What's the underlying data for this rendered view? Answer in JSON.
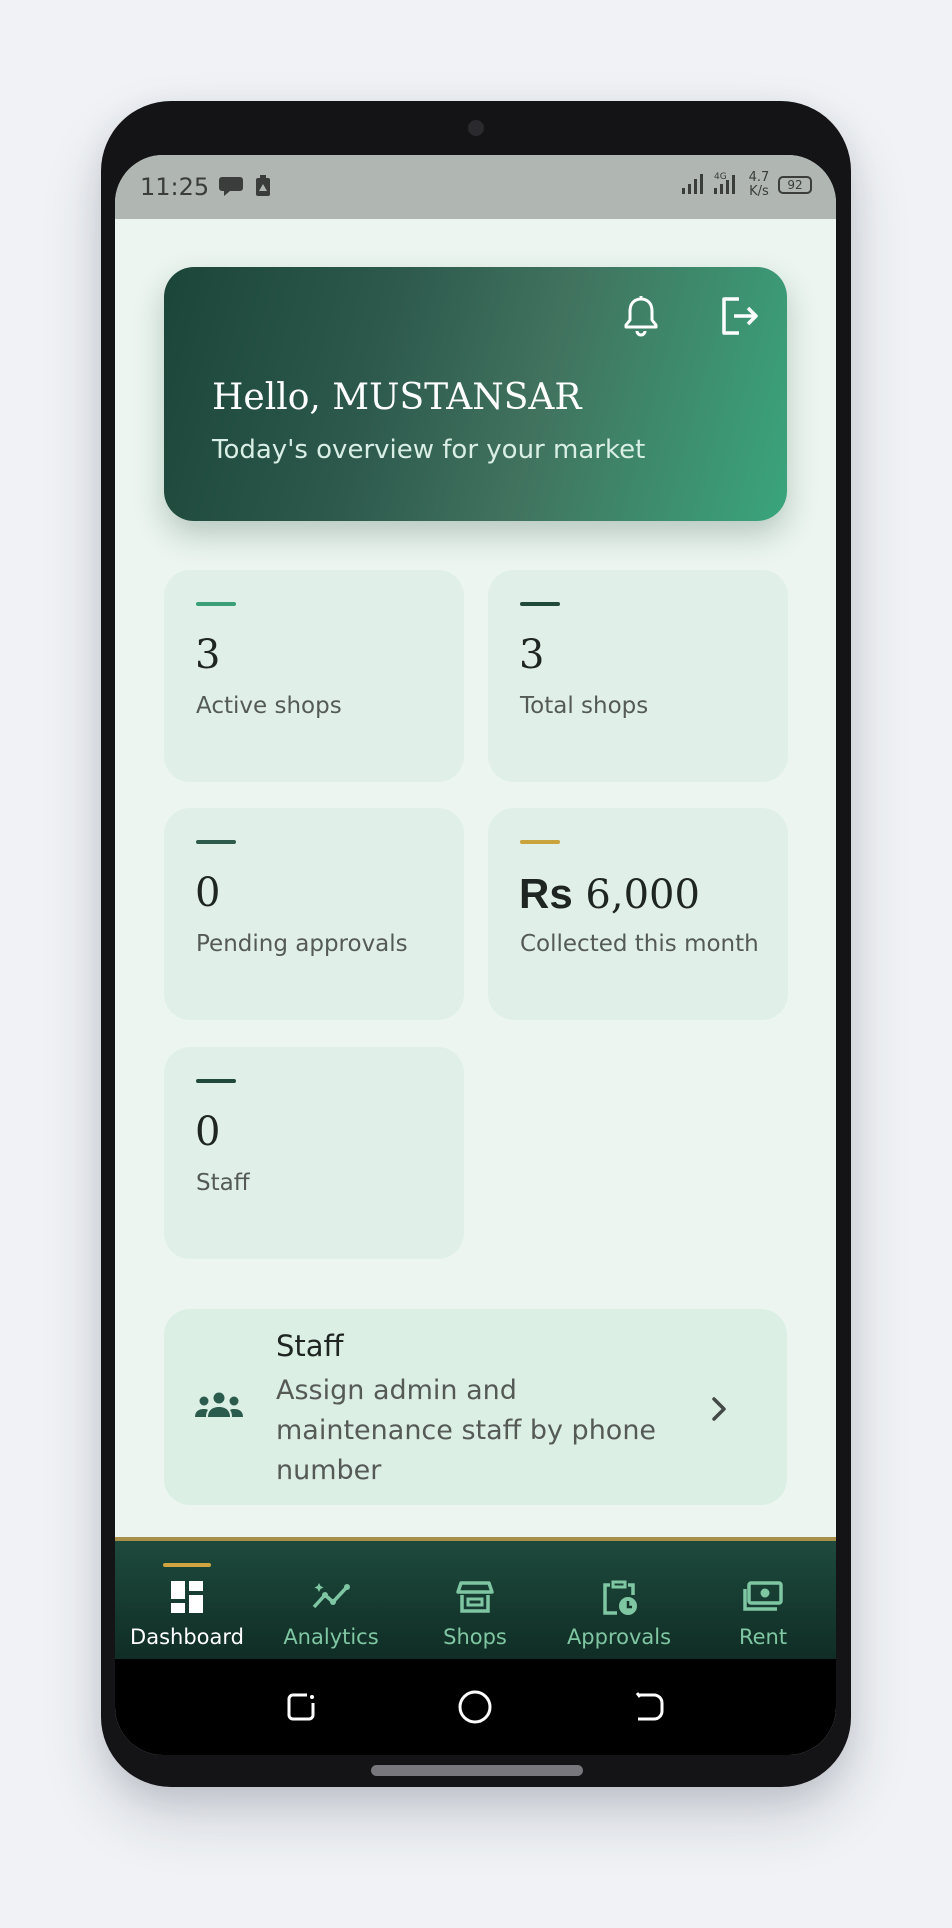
{
  "status_bar": {
    "time": "11:25",
    "network": "4G",
    "speed": "4.7\nK/s",
    "battery": "92"
  },
  "hero": {
    "greeting": "Hello, MUSTANSAR",
    "subtitle": "Today's overview for your market"
  },
  "stats": [
    {
      "value": "3",
      "label": "Active shops",
      "accent": "#3b9f78"
    },
    {
      "value": "3",
      "label": "Total shops",
      "accent": "#21493c"
    },
    {
      "value": "0",
      "label": "Pending approvals",
      "accent": "#2d5b4c"
    },
    {
      "currency": "Rs",
      "value": "6,000",
      "label": "Collected this month",
      "accent": "#c9a33c"
    },
    {
      "value": "0",
      "label": "Staff",
      "accent": "#21493c"
    }
  ],
  "staff_card": {
    "title": "Staff",
    "description": "Assign admin and maintenance staff by phone number"
  },
  "bottom_nav": {
    "items": [
      {
        "label": "Dashboard",
        "icon": "dashboard-icon",
        "active": true
      },
      {
        "label": "Analytics",
        "icon": "analytics-icon"
      },
      {
        "label": "Shops",
        "icon": "shop-icon"
      },
      {
        "label": "Approvals",
        "icon": "approvals-icon"
      },
      {
        "label": "Rent",
        "icon": "cash-icon"
      }
    ]
  },
  "colors": {
    "primary_dark": "#1b4538",
    "primary": "#3aa57d",
    "card_bg": "#e0f0e8",
    "nav_active_indicator": "#d1a53f"
  }
}
